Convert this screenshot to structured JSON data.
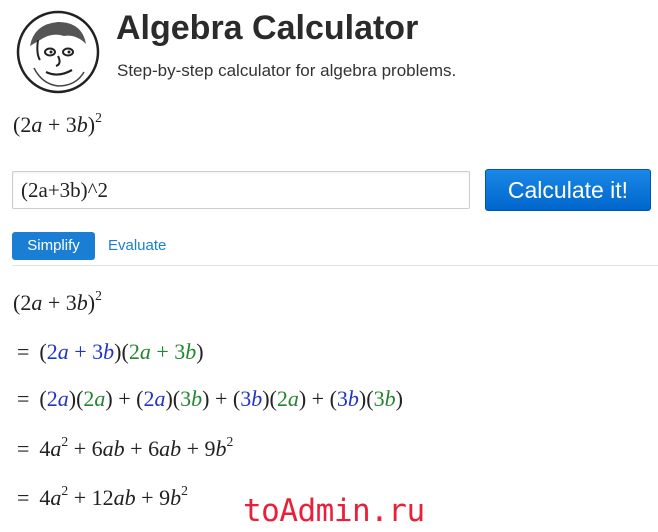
{
  "header": {
    "title": "Algebra Calculator",
    "subtitle": "Step-by-step calculator for algebra problems.",
    "logo_icon": "cartoon-face-icon"
  },
  "input": {
    "value": "(2a+3b)^2"
  },
  "calculate_button": {
    "label": "Calculate it!"
  },
  "tabs": [
    {
      "label": "Simplify",
      "active": true
    },
    {
      "label": "Evaluate",
      "active": false
    }
  ],
  "math": {
    "preview": "(2a + 3b)^2",
    "steps": [
      "(2a + 3b)^2",
      "= (2a + 3b)(2a + 3b)",
      "= (2a)(2a) + (2a)(3b) + (3b)(2a) + (3b)(3b)",
      "= 4a^2 + 6ab + 6ab + 9b^2",
      "= 4a^2 + 12ab + 9b^2"
    ]
  },
  "watermark": {
    "text": "toAdmin.ru"
  },
  "colors": {
    "accent": "#1a7fd4",
    "button": "#0066cc",
    "factor_blue": "#2233cc",
    "factor_green": "#23862f",
    "watermark": "#e8203a"
  }
}
